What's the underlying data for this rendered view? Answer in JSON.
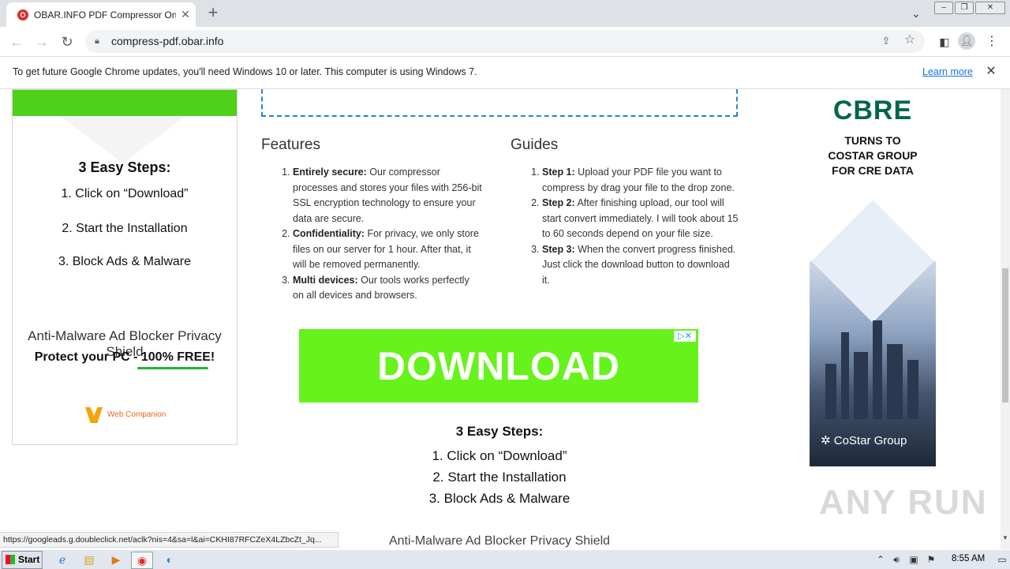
{
  "browser": {
    "tab_title": "OBAR.INFO PDF Compressor Online",
    "tab_favicon": "O",
    "new_tab_symbol": "+",
    "url": "compress-pdf.obar.info",
    "icons": {
      "back": "arrow-left",
      "forward": "arrow-right",
      "reload": "reload",
      "lock": "lock",
      "share": "share",
      "star": "star",
      "sidepanel": "side-panel",
      "profile": "profile",
      "menu": "kebab-menu"
    }
  },
  "infobar": {
    "message": "To get future Google Chrome updates, you'll need Windows 10 or later. This computer is using Windows 7.",
    "link": "Learn more"
  },
  "left_ad": {
    "steps_title": "3 Easy Steps:",
    "steps": [
      "1. Click on “Download”",
      "2. Start the Installation",
      "3. Block Ads & Malware"
    ],
    "headline": "Anti-Malware Ad Blocker Privacy Shield",
    "subline": "Protect your PC - 100% FREE!",
    "brand": "Web Companion",
    "accent_color": "#4fd11a"
  },
  "features": {
    "title": "Features",
    "items": [
      {
        "label": "Entirely secure:",
        "text": " Our compressor processes and stores your files with 256-bit SSL encryption technology to ensure your data are secure."
      },
      {
        "label": "Confidentiality:",
        "text": " For privacy, we only store files on our server for 1 hour. After that, it will be removed permanently."
      },
      {
        "label": "Multi devices:",
        "text": " Our tools works perfectly on all devices and browsers."
      }
    ]
  },
  "guides": {
    "title": "Guides",
    "items": [
      {
        "label": "Step 1:",
        "text": " Upload your PDF file you want to compress by drag your file to the drop zone."
      },
      {
        "label": "Step 2:",
        "text": " After finishing upload, our tool will start convert immediately. I will took about 15 to 60 seconds depend on your file size."
      },
      {
        "label": "Step 3:",
        "text": " When the convert progress finished. Just click the download button to download it."
      }
    ]
  },
  "download_ad": {
    "label": "DOWNLOAD",
    "adchoices": "▷✕",
    "color": "#66f21b"
  },
  "center_ad": {
    "steps_title": "3 Easy Steps:",
    "steps": [
      "1. Click on “Download”",
      "2. Start the Installation",
      "3. Block Ads & Malware"
    ],
    "headline": "Anti-Malware Ad Blocker Privacy Shield"
  },
  "right_ad": {
    "logo": "CBRE",
    "text_lines": [
      "TURNS TO",
      "COSTAR GROUP",
      "FOR CRE DATA"
    ],
    "brand": "CoStar Group",
    "logo_color": "#00664a"
  },
  "status_url": "https://googleads.g.doubleclick.net/aclk?nis=4&sa=l&ai=CKHI87RFCZeX4LZbcZt_Jq...",
  "watermark": "ANY RUN",
  "taskbar": {
    "start_label": "Start",
    "clock": "8:55 AM",
    "apps": [
      "internet-explorer",
      "explorer-folder",
      "media-player",
      "chrome",
      "edge"
    ]
  }
}
